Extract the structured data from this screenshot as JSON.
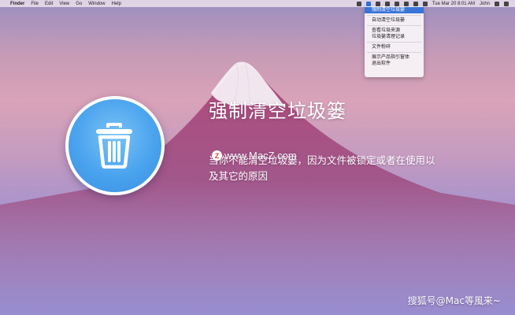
{
  "menubar": {
    "apple_glyph": "",
    "menus": [
      "Finder",
      "File",
      "Edit",
      "View",
      "Go",
      "Window",
      "Help"
    ],
    "clock": "Tue Mar 20  8:01 AM",
    "user": "John"
  },
  "dropdown": {
    "items": [
      {
        "label": "强制清空垃圾篓",
        "active": true
      },
      {
        "label": "自动清空垃圾篓"
      },
      {
        "label": "查看垃圾来源"
      },
      {
        "label": "垃圾篓清理记录"
      },
      {
        "label": "文件粉碎"
      },
      {
        "label": "展示产品指引窗体"
      },
      {
        "label": "退出软件"
      }
    ]
  },
  "hero": {
    "icon": "trash-icon",
    "title": "强制清空垃圾篓",
    "description": "当你不能清空垃圾篓，因为文件被锁定或者在使用以及其它的原因"
  },
  "watermark": {
    "logo_letter": "Z",
    "text": "www.MacZ.com"
  },
  "credit": "搜狐号@Mac等風来~",
  "colors": {
    "accent": "#3a74d9",
    "icon_blue": "#4aa3ee"
  }
}
